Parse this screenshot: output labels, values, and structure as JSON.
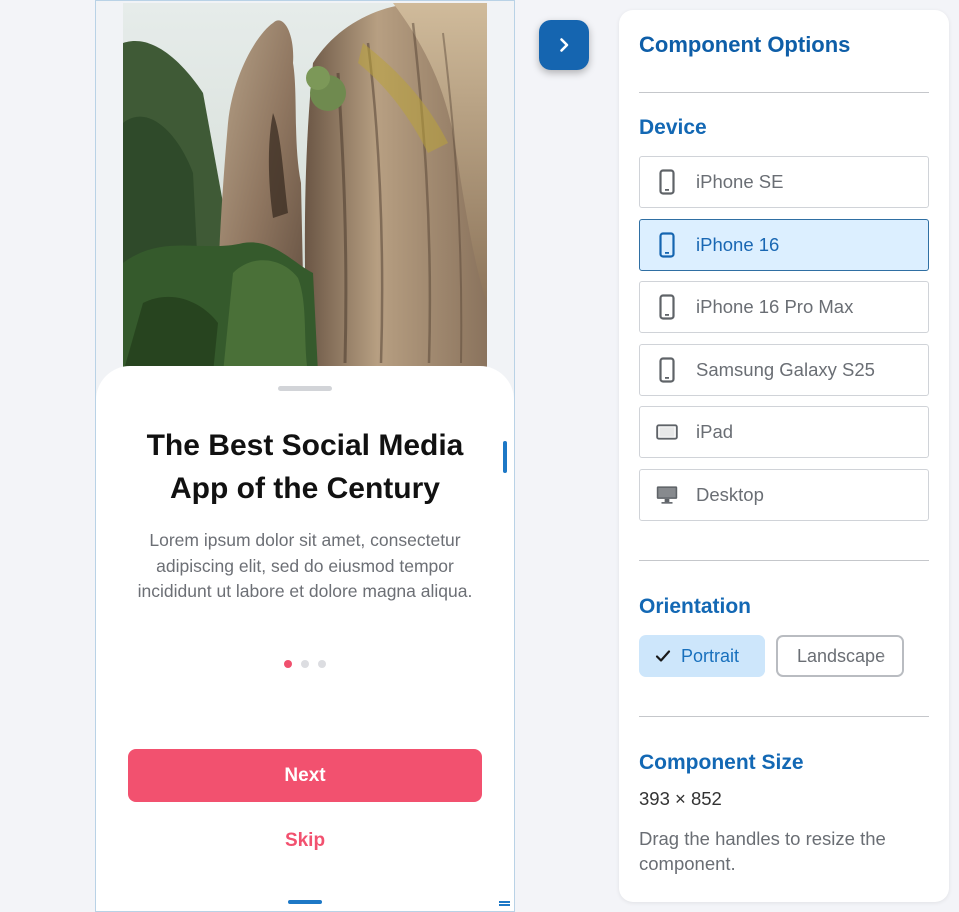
{
  "preview": {
    "hero_image_alt": "Sandstone rock formation",
    "title": "The Best Social Media App of the Century",
    "body": "Lorem ipsum dolor sit amet, consectetur adipiscing elit, sed do eiusmod tempor incididunt ut labore et dolore magna aliqua.",
    "pagination": {
      "total": 3,
      "active_index": 0
    },
    "next_label": "Next",
    "skip_label": "Skip"
  },
  "toggle": {
    "icon": "chevron-right-icon"
  },
  "options_panel": {
    "title": "Component Options",
    "device_section": "Device",
    "devices": [
      {
        "label": "iPhone SE",
        "icon": "phone-icon",
        "selected": false
      },
      {
        "label": "iPhone 16",
        "icon": "phone-icon",
        "selected": true
      },
      {
        "label": "iPhone 16 Pro Max",
        "icon": "phone-icon",
        "selected": false
      },
      {
        "label": "Samsung Galaxy S25",
        "icon": "phone-icon",
        "selected": false
      },
      {
        "label": "iPad",
        "icon": "tablet-icon",
        "selected": false
      },
      {
        "label": "Desktop",
        "icon": "desktop-icon",
        "selected": false
      }
    ],
    "orientation_section": "Orientation",
    "orientation": {
      "portrait_label": "Portrait",
      "landscape_label": "Landscape",
      "selected": "portrait"
    },
    "size_section": "Component Size",
    "size_value": "393 × 852",
    "size_hint": "Drag the handles to resize the component."
  },
  "colors": {
    "accent": "#1565b0",
    "primary_button": "#f2516f",
    "selected_device_bg": "#dcefff",
    "panel_heading": "#0e5ea8"
  }
}
